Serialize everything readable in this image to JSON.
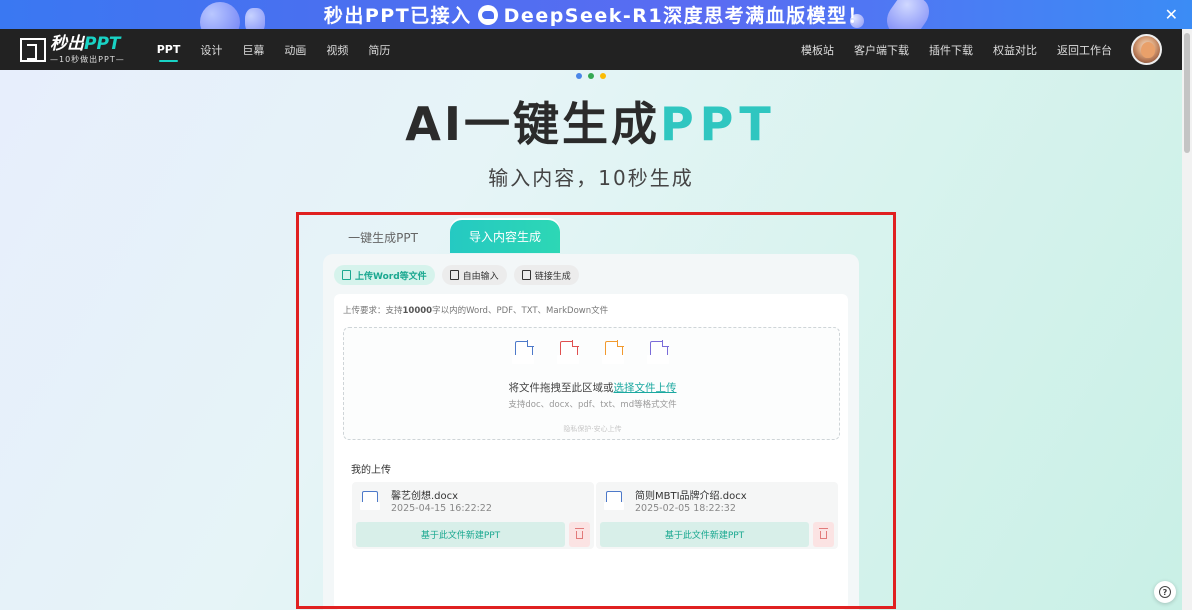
{
  "banner": {
    "text_prefix": "秒出PPT已接入",
    "text_suffix": "DeepSeek-R1深度思考满血版模型！",
    "close": "✕"
  },
  "nav": {
    "logo_main": "秒出",
    "logo_ppt": "PPT",
    "logo_sub": "—10秒做出PPT—",
    "items": [
      "PPT",
      "设计",
      "巨幕",
      "动画",
      "视频",
      "简历"
    ],
    "right_items": [
      "模板站",
      "客户端下载",
      "插件下载",
      "权益对比",
      "返回工作台"
    ]
  },
  "hero": {
    "title_dark": "AI一键生成",
    "title_highlight": "PPT",
    "subtitle": "输入内容，10秒生成",
    "dot_colors": [
      "#4a86e8",
      "#34a853",
      "#fbbc05"
    ]
  },
  "tabs": [
    "一键生成PPT",
    "导入内容生成"
  ],
  "subtabs": [
    "上传Word等文件",
    "自由输入",
    "链接生成"
  ],
  "upload": {
    "req_prefix": "上传要求：支持",
    "req_bold": "10000",
    "req_suffix": "字以内的Word、PDF、TXT、MarkDown文件",
    "file_types": [
      {
        "label": "Word",
        "color": "#4d79c9"
      },
      {
        "label": "PDF",
        "color": "#e05050"
      },
      {
        "label": "TXT",
        "color": "#f29a2e"
      },
      {
        "label": "MD",
        "color": "#7b6cd9"
      }
    ],
    "drop_text": "将文件拖拽至此区域或",
    "drop_link": "选择文件上传",
    "formats": "支持doc、docx、pdf、txt、md等格式文件",
    "privacy": "隐私保护·安心上传"
  },
  "my_uploads": {
    "title": "我的上传",
    "doc_tag": "Word",
    "items": [
      {
        "name": "馨艺创想.docx",
        "time": "2025-04-15 16:22:22",
        "button": "基于此文件新建PPT"
      },
      {
        "name": "简则MBTI品牌介绍.docx",
        "time": "2025-02-05 18:22:32",
        "button": "基于此文件新建PPT"
      }
    ]
  },
  "help": "?"
}
